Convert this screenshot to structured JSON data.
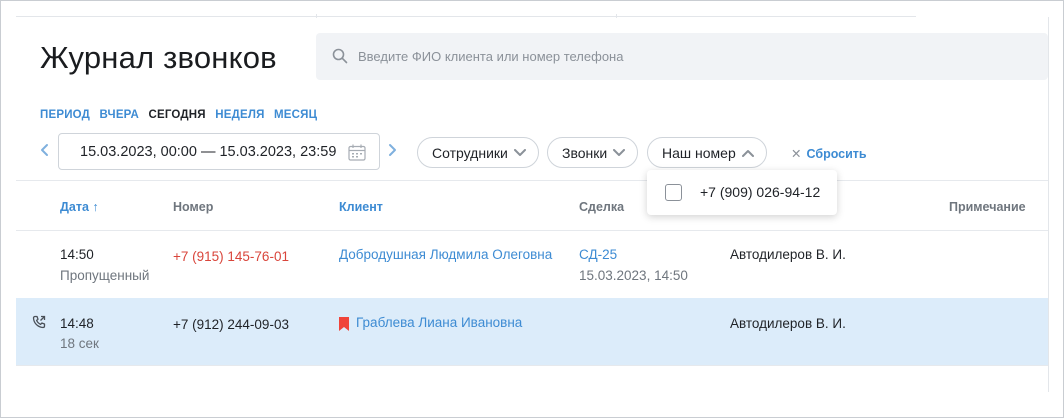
{
  "page": {
    "title": "Журнал звонков"
  },
  "search": {
    "placeholder": "Введите ФИО клиента или номер телефона"
  },
  "period": {
    "options": [
      "ПЕРИОД",
      "ВЧЕРА",
      "СЕГОДНЯ",
      "НЕДЕЛЯ",
      "МЕСЯЦ"
    ],
    "selected": "СЕГОДНЯ"
  },
  "date_range": {
    "value": "15.03.2023, 00:00 — 15.03.2023, 23:59"
  },
  "filters": {
    "employees": "Сотрудники",
    "calls": "Звонки",
    "our_number": "Наш номер",
    "reset": "Сбросить"
  },
  "dropdown": {
    "option": "+7 (909) 026-94-12"
  },
  "table": {
    "headers": {
      "date": "Дата ↑",
      "number": "Номер",
      "client": "Клиент",
      "deal": "Сделка",
      "note": "Примечание"
    },
    "rows": [
      {
        "time": "14:50",
        "sub": "Пропущенный",
        "number": "+7 (915) 145-76-01",
        "client": "Добродушная Людмила Олеговна",
        "deal": "СД-25",
        "deal_date": "15.03.2023, 14:50",
        "employee": "Автодилеров В. И."
      },
      {
        "time": "14:48",
        "sub": "18 сек",
        "number": "+7 (912) 244-09-03",
        "client": "Граблева Лиана Ивановна",
        "deal": "",
        "deal_date": "",
        "employee": "Автодилеров В. И."
      }
    ]
  },
  "colors": {
    "accent": "#3d8bd3",
    "missed": "#d9453b",
    "row_highlight": "#dcecfa",
    "bookmark": "#f0443a"
  }
}
